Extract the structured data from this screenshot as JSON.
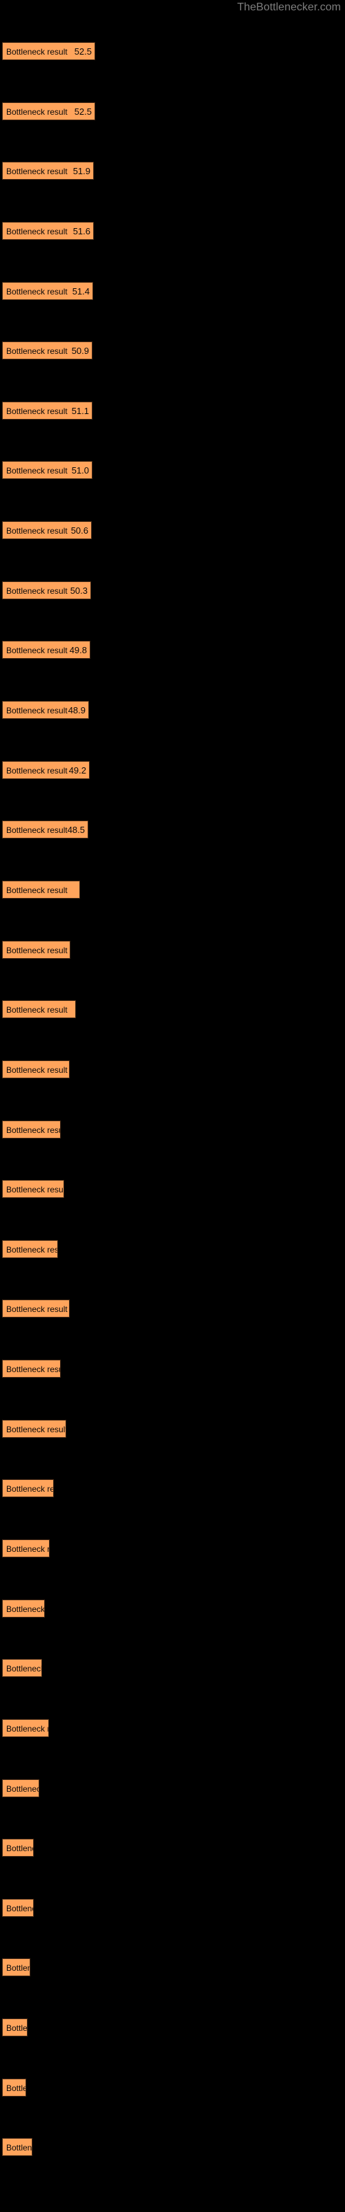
{
  "site": {
    "watermark": "TheBottlenecker.com"
  },
  "chart_data": {
    "type": "bar",
    "orientation": "horizontal",
    "title": "",
    "xlabel": "",
    "ylabel": "",
    "grid": false,
    "legend": null,
    "bar_color": "#ffa45c",
    "bar_border_color": "#4a2d18",
    "background_color": "#000000",
    "text_color": "#0a0a0a",
    "watermark_color": "#7d7d7d",
    "xlim": [
      0,
      55
    ],
    "categories": [
      "Bottleneck result",
      "Bottleneck result",
      "Bottleneck result",
      "Bottleneck result",
      "Bottleneck result",
      "Bottleneck result",
      "Bottleneck result",
      "Bottleneck result",
      "Bottleneck result",
      "Bottleneck result",
      "Bottleneck result",
      "Bottleneck result",
      "Bottleneck result",
      "Bottleneck result",
      "Bottleneck result",
      "Bottleneck result",
      "Bottleneck result",
      "Bottleneck result",
      "Bottleneck result",
      "Bottleneck result",
      "Bottleneck result",
      "Bottleneck result",
      "Bottleneck result",
      "Bottleneck result",
      "Bottleneck result",
      "Bottleneck result",
      "Bottleneck result",
      "Bottleneck result",
      "Bottleneck result",
      "Bottleneck result",
      "Bottleneck result",
      "Bottleneck result",
      "Bottleneck result",
      "Bottleneck result",
      "Bottleneck result",
      "Bottleneck result"
    ],
    "values": [
      52.5,
      52.5,
      51.9,
      51.6,
      51.4,
      50.9,
      51.1,
      51.0,
      50.6,
      50.3,
      49.8,
      48.9,
      49.2,
      48.5,
      44.0,
      38.5,
      41.5,
      38.0,
      33.0,
      35.0,
      31.5,
      38.0,
      33.0,
      36.0,
      29.0,
      27.0,
      24.0,
      22.5,
      26.5,
      21.0,
      18.0,
      18.0,
      16.0,
      14.5,
      13.5,
      17.0
    ],
    "value_labels": [
      "52.5",
      "52.5",
      "51.9",
      "51.6",
      "51.4",
      "50.9",
      "51.1",
      "51.0",
      "50.6",
      "50.3",
      "49.8",
      "48.9",
      "49.2",
      "48.5",
      "",
      "",
      "",
      "",
      "",
      "",
      "",
      "",
      "",
      "",
      "",
      "",
      "",
      "",
      "",
      "",
      "",
      "",
      "",
      "",
      "",
      ""
    ],
    "bar_pixel_widths": [
      135,
      135,
      133,
      132,
      131,
      129,
      130,
      130,
      128,
      127,
      126,
      124,
      125,
      123,
      110,
      96,
      104,
      96,
      83,
      88,
      79,
      96,
      83,
      90,
      73,
      68,
      60,
      57,
      67,
      53,
      46,
      46,
      41,
      37,
      34,
      43
    ],
    "bar_pixel_tops": [
      61,
      104,
      147,
      190,
      233,
      276,
      319,
      362,
      405,
      448,
      491,
      534,
      577,
      620,
      663,
      706,
      749,
      792,
      835,
      878,
      921,
      964,
      1007,
      1050,
      1093,
      1136,
      1179,
      1222,
      1265,
      1308,
      1351,
      1394,
      1437,
      1480,
      1523,
      1566
    ]
  }
}
